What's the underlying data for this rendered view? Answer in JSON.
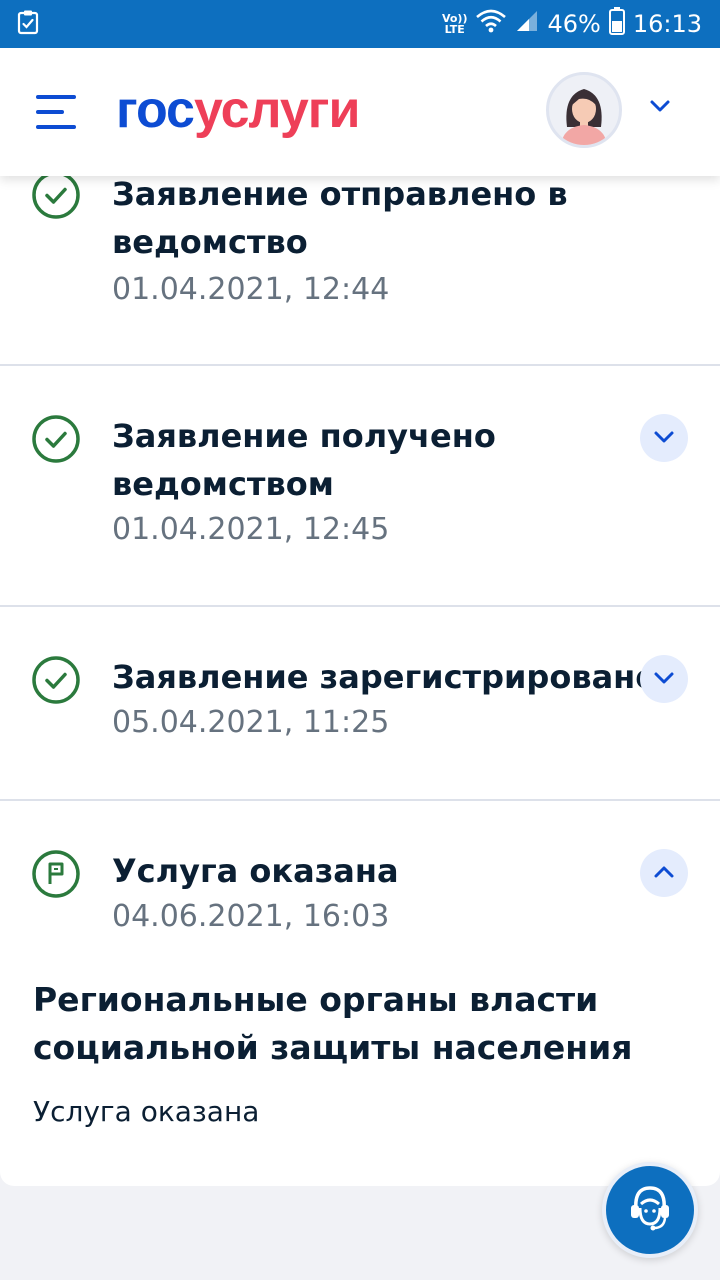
{
  "status_bar": {
    "network_top": "Vo))",
    "network_bottom": "LTE",
    "battery": "46%",
    "time": "16:13"
  },
  "header": {
    "logo_part1": "гос",
    "logo_part2": "услуги",
    "brand_colors": {
      "primary": "#0d4cd3",
      "accent": "#ee3f58"
    }
  },
  "history": [
    {
      "title": "Заявление отправлено в ведомство",
      "date": "01.04.2021, 12:44",
      "icon": "check-circle-icon"
    },
    {
      "title": "Заявление получено ведомством",
      "date": "01.04.2021, 12:45",
      "icon": "check-circle-icon"
    },
    {
      "title": "Заявление зарегистрировано",
      "date": "05.04.2021, 11:25",
      "icon": "check-circle-icon"
    },
    {
      "title": "Услуга оказана",
      "date": "04.06.2021, 16:03",
      "icon": "flag-circle-icon"
    }
  ],
  "detail": {
    "org": "Региональные органы власти социальной защиты населения",
    "result": "Услуга оказана"
  }
}
